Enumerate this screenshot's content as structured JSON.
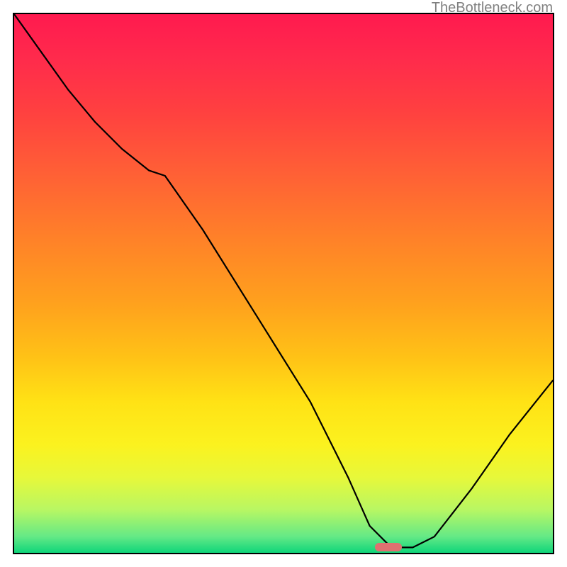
{
  "watermark": "TheBottleneck.com",
  "chart_data": {
    "type": "line",
    "title": "",
    "xlabel": "",
    "ylabel": "",
    "xlim": [
      0,
      1
    ],
    "ylim": [
      0,
      1
    ],
    "x": [
      0.0,
      0.05,
      0.1,
      0.15,
      0.2,
      0.25,
      0.28,
      0.35,
      0.45,
      0.55,
      0.62,
      0.66,
      0.7,
      0.74,
      0.78,
      0.85,
      0.92,
      1.0
    ],
    "values": [
      1.0,
      0.93,
      0.86,
      0.8,
      0.75,
      0.71,
      0.7,
      0.6,
      0.44,
      0.28,
      0.14,
      0.05,
      0.01,
      0.01,
      0.03,
      0.12,
      0.22,
      0.32
    ],
    "marker_xrange": [
      0.67,
      0.72
    ],
    "background_gradient_stops": [
      {
        "pos": 0.0,
        "color": "#ff1a4f"
      },
      {
        "pos": 0.3,
        "color": "#ff6135"
      },
      {
        "pos": 0.64,
        "color": "#ffc316"
      },
      {
        "pos": 0.86,
        "color": "#e7f83a"
      },
      {
        "pos": 1.0,
        "color": "#0fd57a"
      }
    ]
  }
}
